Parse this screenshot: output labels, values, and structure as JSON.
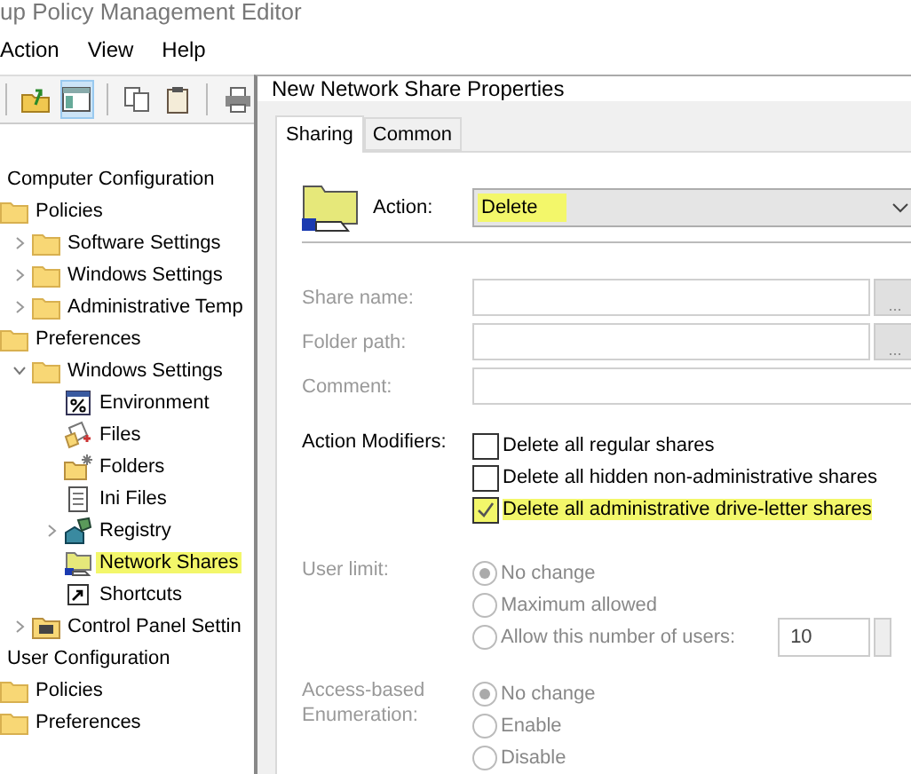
{
  "background_window": {
    "title": "up Policy Management Editor",
    "menu": [
      "Action",
      "View",
      "Help"
    ],
    "toolbar": [
      {
        "kind": "separator"
      },
      {
        "kind": "up",
        "selected": false
      },
      {
        "kind": "tree",
        "selected": true
      },
      {
        "kind": "separator"
      },
      {
        "kind": "copy",
        "selected": false
      },
      {
        "kind": "paste",
        "selected": false
      },
      {
        "kind": "separator"
      },
      {
        "kind": "print",
        "selected": false
      }
    ],
    "tree": [
      {
        "label": "Computer Configuration",
        "children": [
          {
            "label": "Policies",
            "kind": "folder",
            "children": [
              {
                "label": "Software Settings",
                "kind": "folder",
                "expanded": false
              },
              {
                "label": "Windows Settings",
                "kind": "folder",
                "expanded": false
              },
              {
                "label": "Administrative Temp",
                "kind": "folder",
                "expanded": false
              }
            ]
          },
          {
            "label": "Preferences",
            "kind": "folder",
            "children": [
              {
                "label": "Windows Settings",
                "kind": "folder",
                "expanded": true,
                "children": [
                  {
                    "label": "Environment",
                    "kind": "environment",
                    "highlighted": false
                  },
                  {
                    "label": "Files",
                    "kind": "files",
                    "highlighted": false
                  },
                  {
                    "label": "Folders",
                    "kind": "folders",
                    "highlighted": false
                  },
                  {
                    "label": "Ini Files",
                    "kind": "ini",
                    "highlighted": false
                  },
                  {
                    "label": "Registry",
                    "kind": "registry",
                    "expanded": false,
                    "highlighted": false
                  },
                  {
                    "label": "Network Shares",
                    "kind": "share",
                    "highlighted": true
                  },
                  {
                    "label": "Shortcuts",
                    "kind": "shortcut",
                    "highlighted": false
                  }
                ]
              },
              {
                "label": "Control Panel Settin",
                "kind": "control",
                "expanded": false
              }
            ]
          }
        ]
      },
      {
        "label": "User Configuration",
        "children": [
          {
            "label": "Policies",
            "kind": "folder"
          },
          {
            "label": "Preferences",
            "kind": "folder"
          }
        ]
      }
    ]
  },
  "dialog": {
    "title": "New Network Share Properties",
    "tabs": [
      {
        "label": "Sharing",
        "selected": true
      },
      {
        "label": "Common",
        "selected": false
      }
    ],
    "action": {
      "label": "Action:",
      "value": "Delete",
      "highlighted": true
    },
    "fields": [
      {
        "label": "Share name:",
        "disabled": true,
        "button": "..."
      },
      {
        "label": "Folder path:",
        "disabled": true,
        "button": "..."
      },
      {
        "label": "Comment:",
        "disabled": true
      }
    ],
    "modifiers": {
      "label": "Action Modifiers:",
      "options": [
        {
          "label": "Delete all regular shares",
          "checked": false,
          "highlighted": false
        },
        {
          "label": "Delete all hidden non-administrative shares",
          "checked": false,
          "highlighted": false
        },
        {
          "label": "Delete all administrative drive-letter shares",
          "checked": true,
          "highlighted": true
        }
      ]
    },
    "user_limit": {
      "label": "User limit:",
      "disabled": true,
      "options": [
        {
          "label": "No change",
          "selected": true
        },
        {
          "label": "Maximum allowed",
          "selected": false
        },
        {
          "label": "Allow this number of users:",
          "selected": false,
          "value": "10"
        }
      ]
    },
    "access_based": {
      "label": "Access-based Enumeration:",
      "disabled": true,
      "options": [
        {
          "label": "No change",
          "selected": true
        },
        {
          "label": "Enable",
          "selected": false
        },
        {
          "label": "Disable",
          "selected": false
        }
      ]
    }
  }
}
